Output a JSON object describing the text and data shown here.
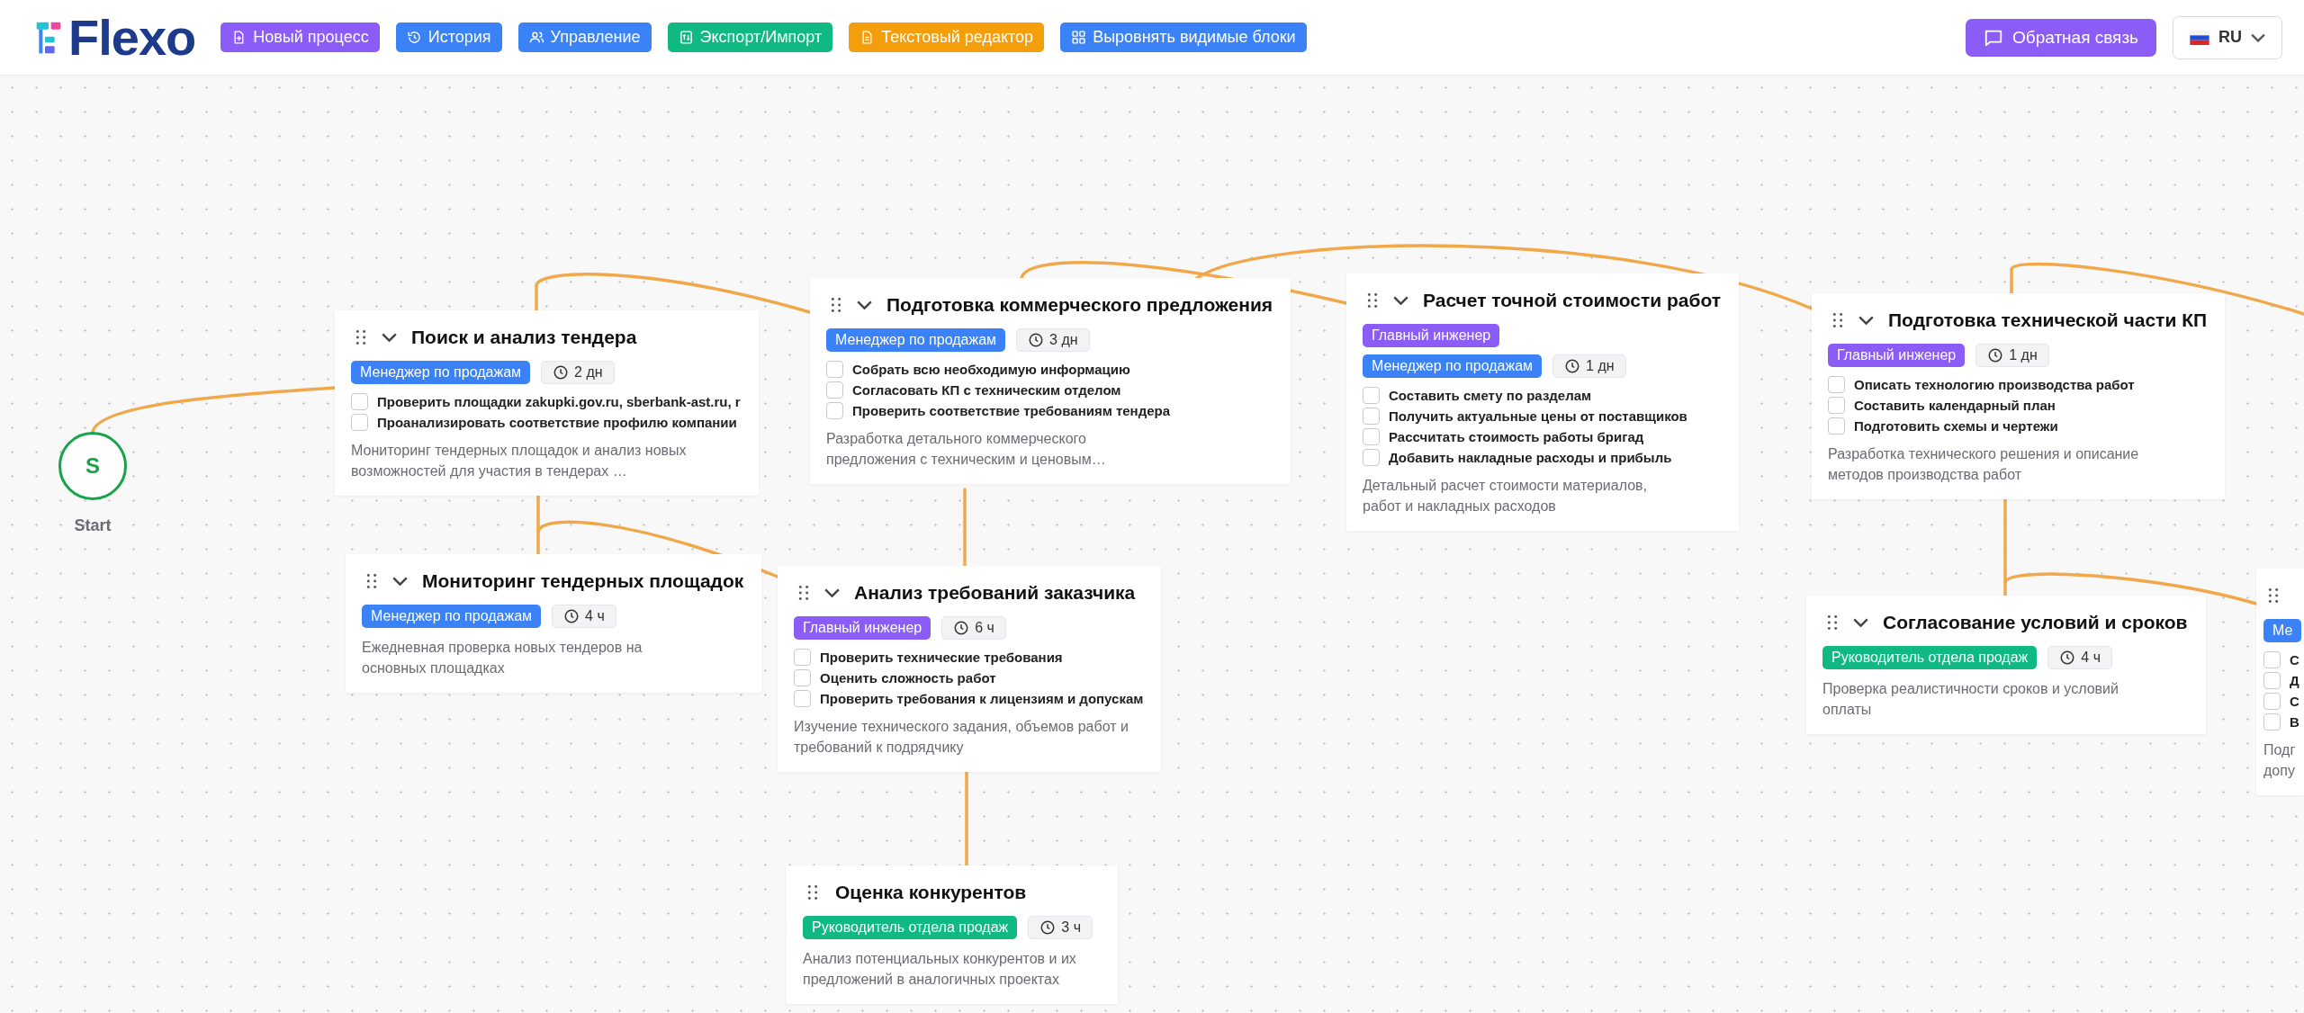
{
  "header": {
    "logo": "Flexo",
    "actions": [
      {
        "kind": "new",
        "label": "Новый процесс",
        "color": "#8b5cf6"
      },
      {
        "kind": "history",
        "label": "История",
        "color": "#3b82f6"
      },
      {
        "kind": "manage",
        "label": "Управление",
        "color": "#3b82f6"
      },
      {
        "kind": "export",
        "label": "Экспорт/Импорт",
        "color": "#10b981"
      },
      {
        "kind": "editor",
        "label": "Текстовый редактор",
        "color": "#f59e0b"
      },
      {
        "kind": "align",
        "label": "Выровнять видимые блоки",
        "color": "#3b82f6"
      }
    ],
    "feedback": {
      "label": "Обратная связь"
    },
    "language": {
      "code": "RU"
    }
  },
  "canvas": {
    "start": {
      "label": "S",
      "caption": "Start"
    },
    "nodes": [
      {
        "title": "Поиск и анализ тендера",
        "collapsible": true,
        "roles": [
          {
            "name": "Менеджер по продажам",
            "color": "#3b82f6"
          }
        ],
        "duration": "2 дн",
        "tasks": [
          {
            "text": "Проверить площадки zakupki.gov.ru, sberbank-ast.ru, r",
            "checked": false
          },
          {
            "text": "Проанализировать соответствие профилю компании",
            "checked": false
          }
        ],
        "description": "Мониторинг тендерных площадок и анализ новых возможностей для участия в тендерах …"
      },
      {
        "title": "Подготовка коммерческого предложения",
        "collapsible": true,
        "roles": [
          {
            "name": "Менеджер по продажам",
            "color": "#3b82f6"
          }
        ],
        "duration": "3 дн",
        "tasks": [
          {
            "text": "Собрать всю необходимую информацию",
            "checked": false
          },
          {
            "text": "Согласовать КП с техническим отделом",
            "checked": false
          },
          {
            "text": "Проверить соответствие требованиям тендера",
            "checked": false
          }
        ],
        "description": "Разработка детального коммерческого предложения с техническим и ценовым…"
      },
      {
        "title": "Мониторинг тендерных площадок",
        "collapsible": true,
        "roles": [
          {
            "name": "Менеджер по продажам",
            "color": "#3b82f6"
          }
        ],
        "duration": "4 ч",
        "description": "Ежедневная проверка новых тендеров на основных площадках"
      },
      {
        "title": "Анализ требований заказчика",
        "collapsible": true,
        "roles": [
          {
            "name": "Главный инженер",
            "color": "#8b5cf6"
          }
        ],
        "duration": "6 ч",
        "tasks": [
          {
            "text": "Проверить технические требования",
            "checked": false
          },
          {
            "text": "Оценить сложность работ",
            "checked": false
          },
          {
            "text": "Проверить требования к лицензиям и допускам",
            "checked": false
          }
        ],
        "description": "Изучение технического задания, объемов работ и требований к подрядчику"
      },
      {
        "title": "Оценка конкурентов",
        "collapsible": false,
        "roles": [
          {
            "name": "Руководитель отдела продаж",
            "color": "#10b981"
          }
        ],
        "duration": "3 ч",
        "description": "Анализ потенциальных конкурентов и их предложений в аналогичных проектах"
      },
      {
        "title": "Расчет точной стоимости работ",
        "collapsible": true,
        "roles": [
          {
            "name": "Главный инженер",
            "color": "#8b5cf6"
          },
          {
            "name": "Менеджер по продажам",
            "color": "#3b82f6"
          }
        ],
        "duration": "1 дн",
        "tasks": [
          {
            "text": "Составить смету по разделам",
            "checked": false
          },
          {
            "text": "Получить актуальные цены от поставщиков",
            "checked": false
          },
          {
            "text": "Рассчитать стоимость работы бригад",
            "checked": false
          },
          {
            "text": "Добавить накладные расходы и прибыль",
            "checked": false
          }
        ],
        "description": "Детальный расчет стоимости материалов, работ и накладных расходов"
      },
      {
        "title": "Подготовка технической части КП",
        "collapsible": true,
        "roles": [
          {
            "name": "Главный инженер",
            "color": "#8b5cf6"
          }
        ],
        "duration": "1 дн",
        "tasks": [
          {
            "text": "Описать технологию производства работ",
            "checked": false
          },
          {
            "text": "Составить календарный план",
            "checked": false
          },
          {
            "text": "Подготовить схемы и чертежи",
            "checked": false
          }
        ],
        "description": "Разработка технического решения и описание методов производства работ"
      },
      {
        "title": "Согласование условий и сроков",
        "collapsible": true,
        "roles": [
          {
            "name": "Руководитель отдела продаж",
            "color": "#10b981"
          }
        ],
        "duration": "4 ч",
        "description": "Проверка реалистичности сроков и условий оплаты"
      },
      {
        "collapsible": false,
        "roles": [
          {
            "name": "Ме",
            "color": "#3b82f6"
          }
        ],
        "tasks": [
          {
            "text": "С",
            "checked": false
          },
          {
            "text": "Д",
            "checked": false
          },
          {
            "text": "С",
            "checked": false
          },
          {
            "text": "В",
            "checked": false
          }
        ],
        "description": "Подг допу"
      }
    ]
  }
}
